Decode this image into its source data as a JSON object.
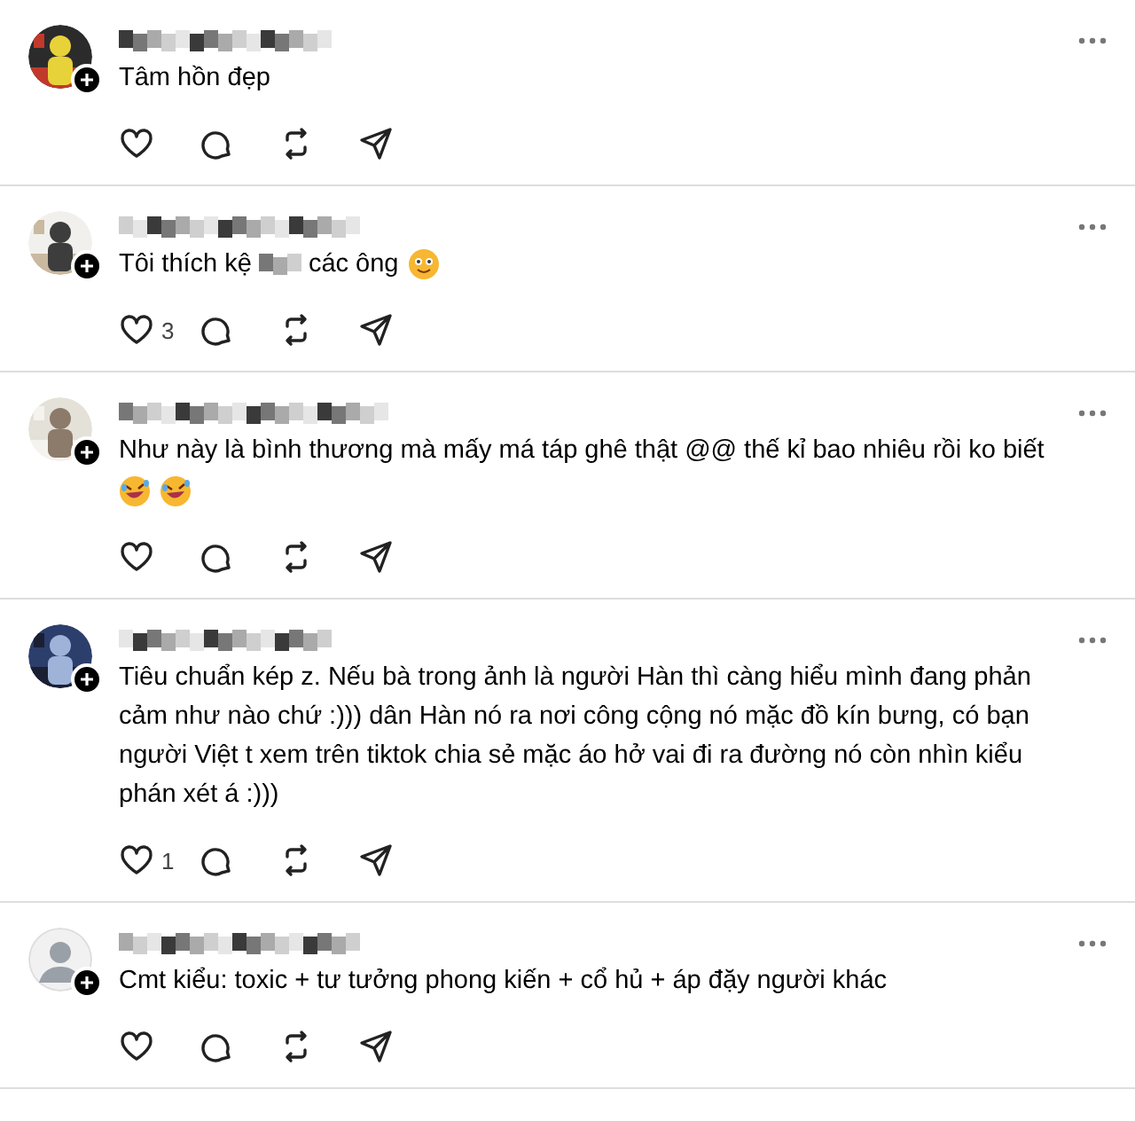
{
  "comments": [
    {
      "avatar": {
        "kind": "picture"
      },
      "lines": [
        [
          {
            "kind": "text",
            "text": "Tâm hồn đẹp"
          }
        ]
      ]
    },
    {
      "avatar": {
        "kind": "picture"
      },
      "lines": [
        [
          {
            "kind": "text",
            "text": "Tôi thích kệ"
          },
          {
            "kind": "redacted"
          },
          {
            "kind": "text",
            "text": "các ông"
          },
          {
            "kind": "smile_emoji"
          }
        ]
      ],
      "likes": "3"
    },
    {
      "avatar": {
        "kind": "picture"
      },
      "lines": [
        [
          {
            "kind": "text",
            "text": "Như này là bình thương mà mấy má táp ghê thật @@ thế kỉ bao nhiêu rồi ko biết"
          }
        ],
        [
          {
            "kind": "laugh_emoji"
          },
          {
            "kind": "laugh_emoji"
          }
        ]
      ]
    },
    {
      "avatar": {
        "kind": "picture"
      },
      "lines": [
        [
          {
            "kind": "text",
            "text": "Tiêu chuẩn kép z. Nếu bà trong ảnh là người Hàn thì càng hiểu mình đang phản cảm như nào chứ :))) dân Hàn nó ra nơi công cộng nó mặc đồ kín bưng, có bạn người Việt t xem trên tiktok chia sẻ mặc áo hở vai đi ra đường nó còn nhìn kiểu phán xét á :)))"
          }
        ]
      ],
      "likes": "1"
    },
    {
      "avatar": {
        "kind": "default"
      },
      "lines": [
        [
          {
            "kind": "text",
            "text": "Cmt kiểu: toxic + tư tưởng phong kiến + cổ hủ + áp đặy người khác"
          }
        ]
      ]
    }
  ]
}
